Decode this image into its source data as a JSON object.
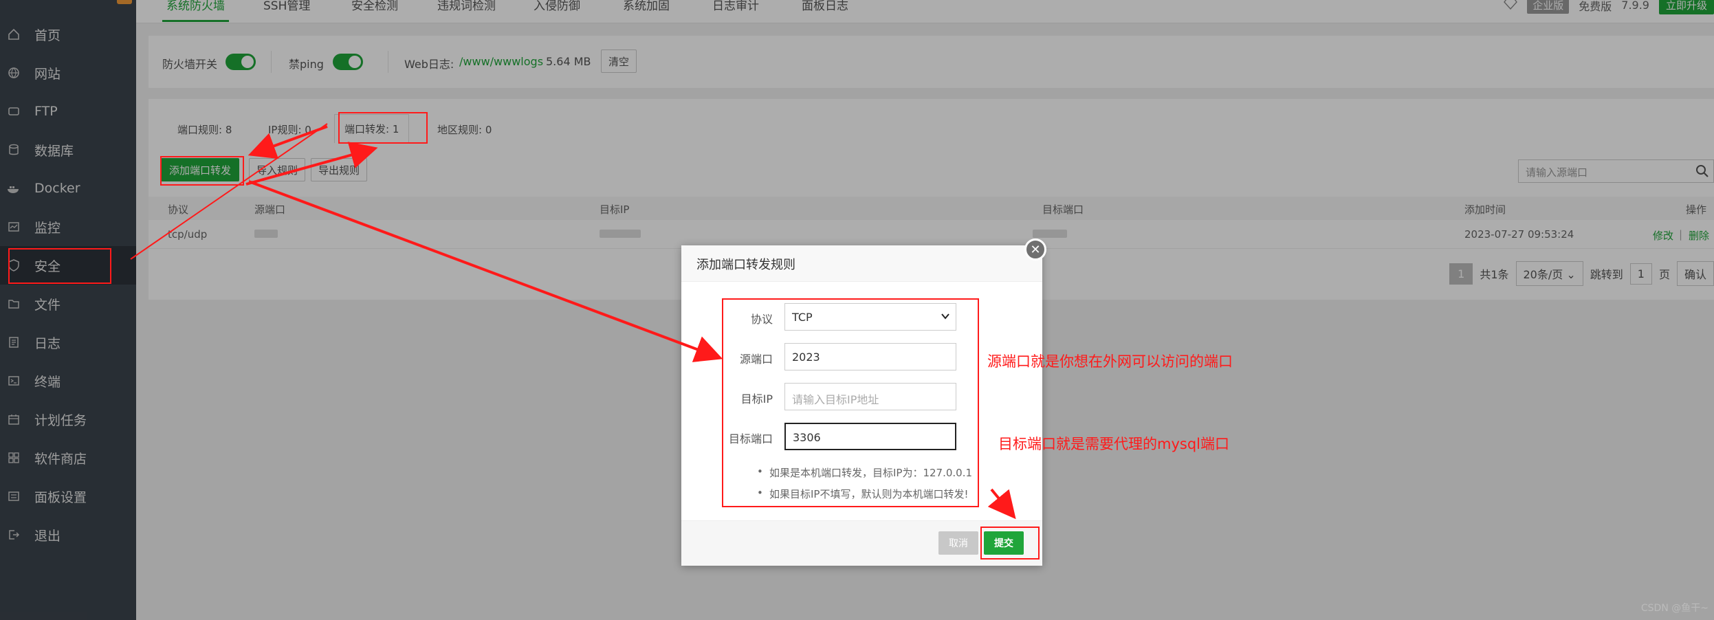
{
  "sidebar": {
    "items": [
      {
        "label": "首页",
        "icon": "home-icon"
      },
      {
        "label": "网站",
        "icon": "globe-icon"
      },
      {
        "label": "FTP",
        "icon": "ftp-icon"
      },
      {
        "label": "数据库",
        "icon": "database-icon"
      },
      {
        "label": "Docker",
        "icon": "docker-icon"
      },
      {
        "label": "监控",
        "icon": "monitor-icon"
      },
      {
        "label": "安全",
        "icon": "shield-icon"
      },
      {
        "label": "文件",
        "icon": "folder-icon"
      },
      {
        "label": "日志",
        "icon": "log-icon"
      },
      {
        "label": "终端",
        "icon": "terminal-icon"
      },
      {
        "label": "计划任务",
        "icon": "calendar-icon"
      },
      {
        "label": "软件商店",
        "icon": "apps-icon"
      },
      {
        "label": "面板设置",
        "icon": "settings-icon"
      },
      {
        "label": "退出",
        "icon": "logout-icon"
      }
    ],
    "active": "安全"
  },
  "topbar": {
    "tabs": [
      "系统防火墙",
      "SSH管理",
      "安全检测",
      "违规词检测",
      "入侵防御",
      "系统加固",
      "日志审计",
      "面板日志"
    ],
    "active_tab": "系统防火墙",
    "edition": "企业版",
    "free_label": "免费版",
    "version": "7.9.9",
    "upgrade": "立即升级"
  },
  "firewall": {
    "switch_label": "防火墙开关",
    "ping_label": "禁ping",
    "weblog_label": "Web日志:",
    "weblog_path": "/www/wwwlogs",
    "weblog_size": "5.64 MB",
    "clear": "清空"
  },
  "rules": {
    "subtabs": [
      "端口规则: 8",
      "IP规则: 0",
      "端口转发: 1",
      "地区规则: 0"
    ],
    "add_button": "添加端口转发",
    "import_button": "导入规则",
    "export_button": "导出规则",
    "search_placeholder": "请输入源端口",
    "columns": [
      "协议",
      "源端口",
      "目标IP",
      "目标端口",
      "添加时间",
      "操作"
    ],
    "row": {
      "protocol": "tcp/udp",
      "time": "2023-07-27 09:53:24",
      "edit": "修改",
      "sep": "|",
      "delete": "删除"
    },
    "pager": {
      "current": "1",
      "total": "共1条",
      "per_page": "20条/页",
      "jump": "跳转到",
      "jump_value": "1",
      "page": "页",
      "confirm": "确认"
    }
  },
  "modal": {
    "title": "添加端口转发规则",
    "protocol_label": "协议",
    "protocol_value": "TCP",
    "src_port_label": "源端口",
    "src_port_value": "2023",
    "dest_ip_label": "目标IP",
    "dest_ip_placeholder": "请输入目标IP地址",
    "dest_port_label": "目标端口",
    "dest_port_value": "3306",
    "tips": [
      "如果是本机端口转发，目标IP为：127.0.0.1",
      "如果目标IP不填写，默认则为本机端口转发!"
    ],
    "cancel": "取消",
    "submit": "提交"
  },
  "annotations": {
    "src_note": "源端口就是你想在外网可以访问的端口",
    "dest_note": "目标端口就是需要代理的mysql端口",
    "color": "#ff1a1a"
  },
  "watermark": "CSDN @鱼干~",
  "colors": {
    "accent": "#20a53a",
    "sidebar": "#3c444d"
  }
}
